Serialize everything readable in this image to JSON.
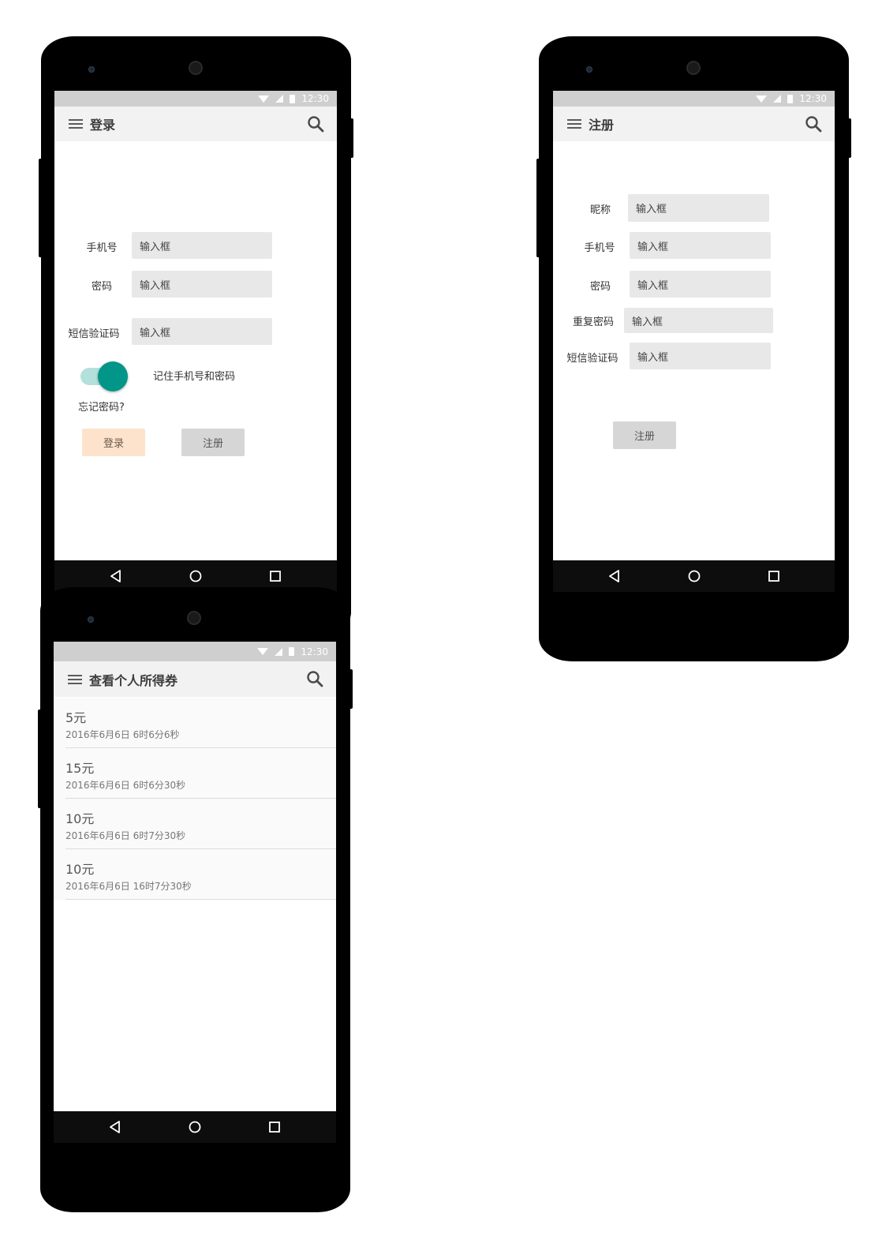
{
  "statusbar": {
    "time": "12:30"
  },
  "login_screen": {
    "title": "登录",
    "phone_label": "手机号",
    "phone_placeholder": "输入框",
    "password_label": "密码",
    "password_placeholder": "输入框",
    "sms_label": "短信验证码",
    "sms_placeholder": "输入框",
    "remember_label": "记住手机号和密码",
    "remember_on": true,
    "forgot_label": "忘记密码?",
    "login_button": "登录",
    "register_button": "注册"
  },
  "register_screen": {
    "title": "注册",
    "nickname_label": "昵称",
    "nickname_placeholder": "输入框",
    "phone_label": "手机号",
    "phone_placeholder": "输入框",
    "password_label": "密码",
    "password_placeholder": "输入框",
    "repeat_label": "重复密码",
    "repeat_placeholder": "输入框",
    "sms_label": "短信验证码",
    "sms_placeholder": "输入框",
    "register_button": "注册"
  },
  "coupon_screen": {
    "title": "查看个人所得券",
    "items": [
      {
        "amount": "5元",
        "datetime": "2016年6月6日 6时6分6秒"
      },
      {
        "amount": "15元",
        "datetime": "2016年6月6日 6时6分30秒"
      },
      {
        "amount": "10元",
        "datetime": "2016年6月6日 6时7分30秒"
      },
      {
        "amount": "10元",
        "datetime": "2016年6月6日 16时7分30秒"
      }
    ]
  },
  "nav": {
    "back": "back-icon",
    "home": "home-icon",
    "recents": "recents-icon"
  },
  "colors": {
    "accent": "#019688",
    "login_button": "#fde3cc",
    "register_button": "#d6d6d6"
  }
}
